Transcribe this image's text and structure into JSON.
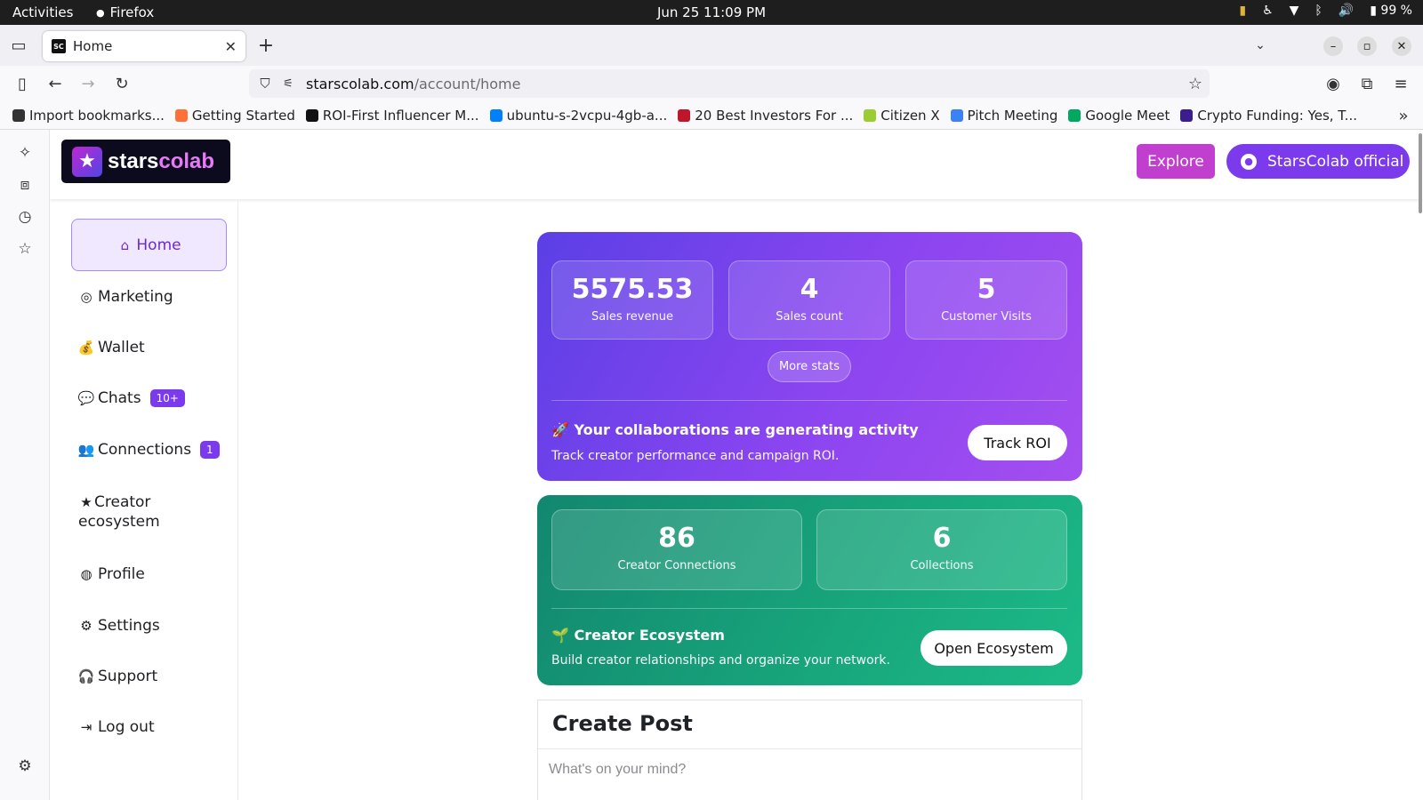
{
  "system": {
    "activities": "Activities",
    "app": "Firefox",
    "clock": "Jun 25  11:09 PM",
    "battery": "99 %"
  },
  "browser": {
    "tab": {
      "favicon_text": "SC",
      "title": "Home"
    },
    "url": {
      "host": "starscolab.com",
      "path": "/account/home"
    },
    "bookmarks": [
      {
        "label": "Import bookmarks...",
        "icon": "import-icon",
        "color": "#333333"
      },
      {
        "label": "Getting Started",
        "icon": "firefox-icon",
        "color": "#ff7139"
      },
      {
        "label": "ROI-First Influencer M...",
        "icon": "sc-icon",
        "color": "#111111"
      },
      {
        "label": "ubuntu-s-2vcpu-4gb-a...",
        "icon": "digitalocean-icon",
        "color": "#0080ff"
      },
      {
        "label": "20 Best Investors For ...",
        "icon": "bookmark-red-icon",
        "color": "#c0162b"
      },
      {
        "label": "Citizen X",
        "icon": "citizenx-icon",
        "color": "#9acd32"
      },
      {
        "label": "Pitch Meeting",
        "icon": "pitch-icon",
        "color": "#3b82f6"
      },
      {
        "label": "Google Meet",
        "icon": "meet-icon",
        "color": "#00a862"
      },
      {
        "label": "Crypto Funding: Yes, T...",
        "icon": "crypto-icon",
        "color": "#3b1d8f"
      }
    ]
  },
  "header": {
    "brand_a": "stars",
    "brand_b": "colab",
    "explore": "Explore",
    "account": "StarsColab official"
  },
  "nav": {
    "home": "Home",
    "marketing": "Marketing",
    "wallet": "Wallet",
    "chats": "Chats",
    "chats_badge": "10+",
    "connections": "Connections",
    "connections_badge": "1",
    "creator_line1": "Creator",
    "creator_line2": "ecosystem",
    "profile": "Profile",
    "settings": "Settings",
    "support": "Support",
    "logout": "Log out"
  },
  "stats": {
    "revenue": {
      "value": "5575.53",
      "label": "Sales revenue"
    },
    "sales": {
      "value": "4",
      "label": "Sales count"
    },
    "visits": {
      "value": "5",
      "label": "Customer Visits"
    },
    "more": "More stats",
    "activity_title": "🚀 Your collaborations are generating activity",
    "activity_sub": "Track creator performance and campaign ROI.",
    "track": "Track ROI"
  },
  "ecosystem": {
    "connections": {
      "value": "86",
      "label": "Creator Connections"
    },
    "collections": {
      "value": "6",
      "label": "Collections"
    },
    "title": "🌱 Creator Ecosystem",
    "sub": "Build creator relationships and organize your network.",
    "open": "Open Ecosystem"
  },
  "post": {
    "title": "Create Post",
    "placeholder": "What's on your mind?"
  },
  "colors": {
    "accent": "#7c3aed",
    "explore": "#c13fcf",
    "green": "#18a77c"
  }
}
